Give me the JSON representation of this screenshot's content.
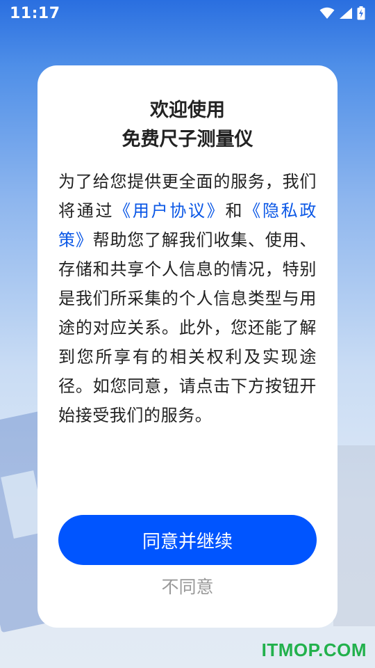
{
  "status_bar": {
    "time": "11:17",
    "icons": [
      "wifi-icon",
      "signal-icon",
      "battery-charging-icon"
    ]
  },
  "dialog": {
    "title_line1": "欢迎使用",
    "title_line2": "免费尺子测量仪",
    "body": {
      "part1": "为了给您提供更全面的服务，我们将通过",
      "link_user_agreement": "《用户协议》",
      "and": "和",
      "link_privacy_policy": "《隐私政策》",
      "part2": "帮助您了解我们收集、使用、存储和共享个人信息的情况，特别是我们所采集的个人信息类型与用途的对应关系。此外，您还能了解到您所享有的相关权利及实现途径。如您同意，请点击下方按钮开始接受我们的服务。"
    },
    "agree_button": "同意并继续",
    "disagree_button": "不同意"
  },
  "watermark": "ITMOP.COM",
  "colors": {
    "accent": "#0055ff",
    "link": "#0a57e6",
    "watermark": "#22b14c"
  }
}
